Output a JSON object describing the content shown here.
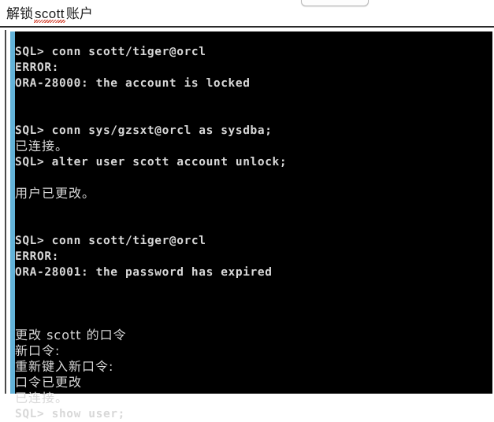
{
  "document": {
    "title_prefix": "解锁",
    "title_keyword": "scott",
    "title_suffix": "账户",
    "spellcheck_color": "#d23c28"
  },
  "toolbar": {
    "stub_button_label": ""
  },
  "terminal": {
    "background_color": "#000000",
    "text_color": "#d8d8d8",
    "accent_bar_color": "#63b2d8",
    "lines": [
      {
        "id": "l01",
        "text": "SQL> conn scott/tiger@orcl",
        "script": "latin"
      },
      {
        "id": "l02",
        "text": "ERROR:",
        "script": "latin"
      },
      {
        "id": "l03",
        "text": "ORA-28000: the account is locked",
        "script": "latin"
      },
      {
        "id": "l04",
        "text": "",
        "script": "blank"
      },
      {
        "id": "l05",
        "text": "",
        "script": "blank"
      },
      {
        "id": "l06",
        "text": "SQL> conn sys/gzsxt@orcl as sysdba;",
        "script": "latin"
      },
      {
        "id": "l07",
        "text": "已连接。",
        "script": "cjk"
      },
      {
        "id": "l08",
        "text": "SQL> alter user scott account unlock;",
        "script": "latin"
      },
      {
        "id": "l09",
        "text": "",
        "script": "blank"
      },
      {
        "id": "l10",
        "text": "用户已更改。",
        "script": "cjk"
      },
      {
        "id": "l11",
        "text": "",
        "script": "blank"
      },
      {
        "id": "l12",
        "text": "",
        "script": "blank"
      },
      {
        "id": "l13",
        "text": "SQL> conn scott/tiger@orcl",
        "script": "latin"
      },
      {
        "id": "l14",
        "text": "ERROR:",
        "script": "latin"
      },
      {
        "id": "l15",
        "text": "ORA-28001: the password has expired",
        "script": "latin"
      },
      {
        "id": "l16",
        "text": "",
        "script": "blank"
      },
      {
        "id": "l17",
        "text": "",
        "script": "blank"
      },
      {
        "id": "l18",
        "text": "",
        "script": "blank"
      },
      {
        "id": "l19",
        "text": "更改 scott 的口令",
        "script": "cjk"
      },
      {
        "id": "l20",
        "text": "新口令:",
        "script": "cjk"
      },
      {
        "id": "l21",
        "text": "重新键入新口令:",
        "script": "cjk"
      },
      {
        "id": "l22",
        "text": "口令已更改",
        "script": "cjk"
      },
      {
        "id": "l23",
        "text": "已连接。",
        "script": "cjk"
      },
      {
        "id": "l24",
        "text": "SQL> show user;",
        "script": "latin"
      }
    ]
  }
}
